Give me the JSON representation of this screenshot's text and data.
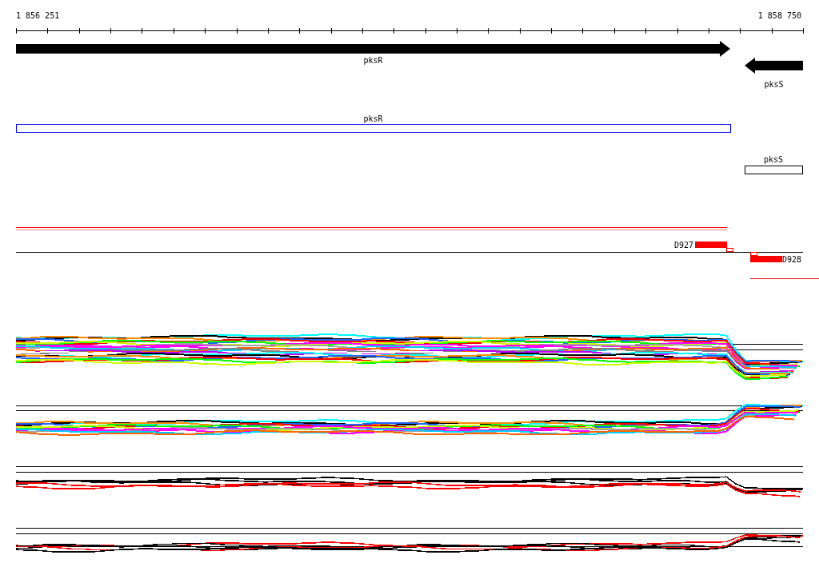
{
  "ruler": {
    "start": "1 856 251",
    "end": "1 858 750"
  },
  "genes": [
    {
      "label": "pksR",
      "kind": "forward"
    },
    {
      "label": "pksS",
      "kind": "reverse"
    }
  ],
  "gene_boxes": [
    {
      "label": "pksR",
      "color": "#0000ff"
    },
    {
      "label": "pksS",
      "color": "#000000"
    }
  ],
  "features": [
    {
      "label": "D927",
      "kind": "forward"
    },
    {
      "label": "D928",
      "kind": "reverse"
    }
  ]
}
